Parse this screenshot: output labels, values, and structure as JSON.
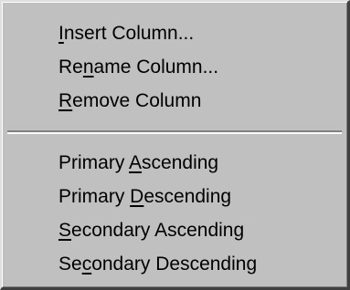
{
  "menu": {
    "groups": [
      {
        "items": [
          {
            "pre": "",
            "mnemonic": "I",
            "post": "nsert Column..."
          },
          {
            "pre": "Re",
            "mnemonic": "n",
            "post": "ame Column..."
          },
          {
            "pre": "",
            "mnemonic": "R",
            "post": "emove Column"
          }
        ]
      },
      {
        "items": [
          {
            "pre": "Primary ",
            "mnemonic": "A",
            "post": "scending"
          },
          {
            "pre": "Primary ",
            "mnemonic": "D",
            "post": "escending"
          },
          {
            "pre": "",
            "mnemonic": "S",
            "post": "econdary Ascending"
          },
          {
            "pre": "Se",
            "mnemonic": "c",
            "post": "ondary Descending"
          }
        ]
      }
    ]
  },
  "colors": {
    "menu_face": "#c0c0c0",
    "text": "#000000",
    "separator_shadow": "#808080",
    "separator_highlight": "#ffffff"
  }
}
